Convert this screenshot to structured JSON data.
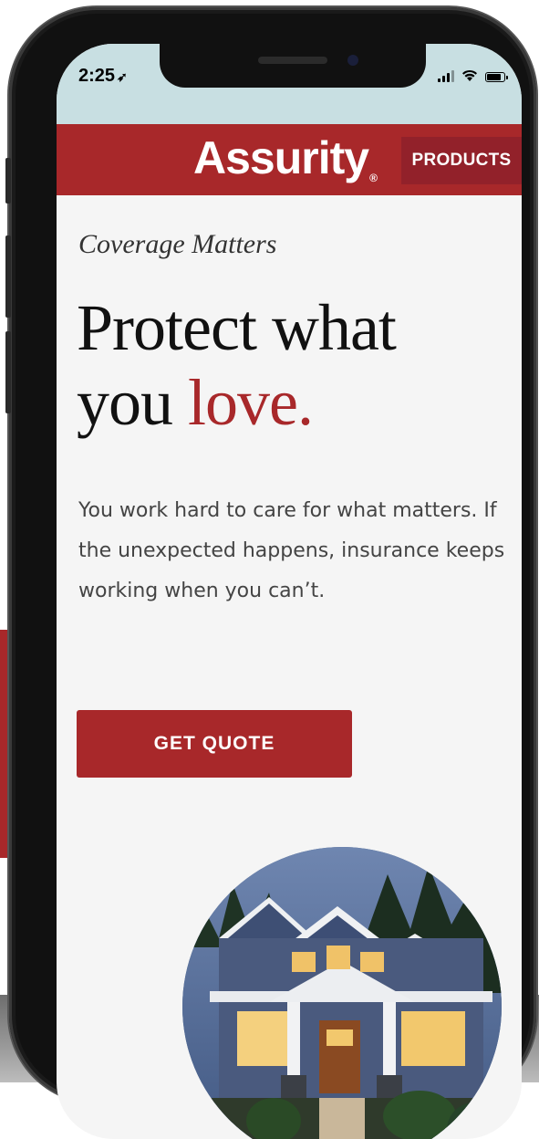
{
  "status_bar": {
    "time": "2:25"
  },
  "header": {
    "logo_text": "Assurity",
    "logo_mark": "®",
    "products_label": "PRODUCTS"
  },
  "hero": {
    "eyebrow": "Coverage Matters",
    "headline_line1": "Protect what",
    "headline_line2_prefix": "you ",
    "headline_line2_accent": "love.",
    "body": "You work hard to care for what matters. If the unexpected happens, insurance keeps working when you can’t.",
    "cta_label": "GET QUOTE"
  },
  "colors": {
    "brand_red": "#a8282a",
    "status_bar_bg": "#c8dfe2",
    "page_bg": "#f5f5f5"
  },
  "icons": [
    "location-arrow-icon",
    "cellular-signal-icon",
    "wifi-icon",
    "battery-icon"
  ]
}
